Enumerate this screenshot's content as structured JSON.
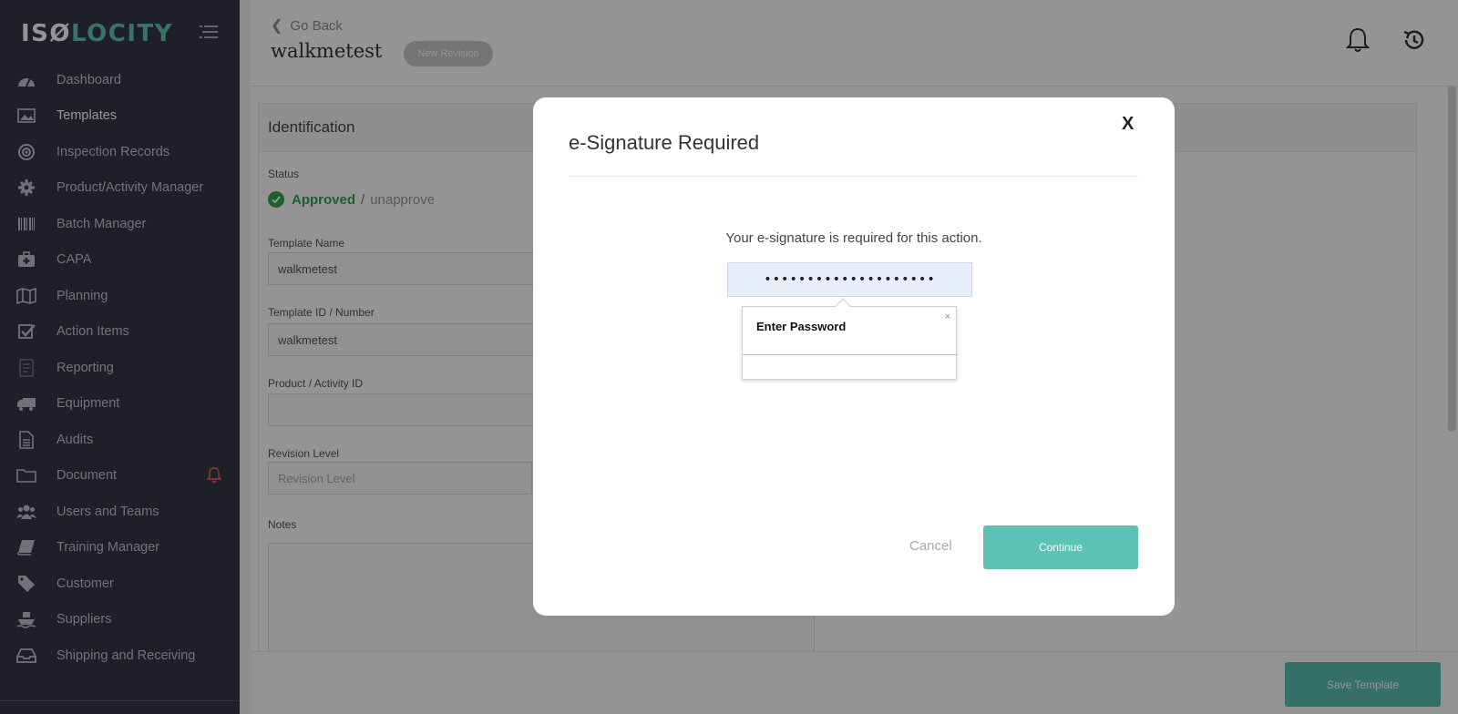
{
  "app": {
    "logo_prefix": "IS",
    "logo_mid": "Ø",
    "logo_suffix": "LOCITY"
  },
  "sidebar": {
    "items": [
      {
        "label": "Dashboard",
        "icon": "dashboard-icon"
      },
      {
        "label": "Templates",
        "icon": "image-icon",
        "active": true
      },
      {
        "label": "Inspection Records",
        "icon": "target-icon"
      },
      {
        "label": "Product/Activity Manager",
        "icon": "gear-icon"
      },
      {
        "label": "Batch Manager",
        "icon": "barcode-icon"
      },
      {
        "label": "CAPA",
        "icon": "medkit-icon"
      },
      {
        "label": "Planning",
        "icon": "map-icon"
      },
      {
        "label": "Action Items",
        "icon": "checkbox-icon"
      },
      {
        "label": "Reporting",
        "icon": "report-icon"
      },
      {
        "label": "Equipment",
        "icon": "truck-icon"
      },
      {
        "label": "Audits",
        "icon": "file-icon"
      },
      {
        "label": "Document",
        "icon": "folder-icon",
        "alert": true
      },
      {
        "label": "Users and Teams",
        "icon": "users-icon"
      },
      {
        "label": "Training Manager",
        "icon": "book-icon"
      },
      {
        "label": "Customer",
        "icon": "tag-icon"
      },
      {
        "label": "Suppliers",
        "icon": "ship-icon"
      },
      {
        "label": "Shipping and Receiving",
        "icon": "inbox-icon"
      }
    ]
  },
  "header": {
    "go_back": "Go Back",
    "title": "walkmetest",
    "revision_button": "New Revision"
  },
  "form": {
    "section_title": "Identification",
    "status_label": "Status",
    "status_value": "Approved",
    "status_separator": "/",
    "unapprove_link": "unapprove",
    "template_name_label": "Template Name",
    "template_name_value": "walkmetest",
    "template_id_label": "Template ID / Number",
    "template_id_value": "walkmetest",
    "product_id_label": "Product / Activity ID",
    "product_id_value": "",
    "revision_label": "Revision Level",
    "revision_placeholder": "Revision Level",
    "notes_label": "Notes",
    "save_button": "Save Template"
  },
  "modal": {
    "close": "X",
    "title": "e-Signature Required",
    "message": "Your e-signature is required for this action.",
    "password_value": "••••••••••••••••••••",
    "tooltip_text": "Enter Password",
    "tooltip_close": "×",
    "cancel": "Cancel",
    "continue": "Continue"
  },
  "colors": {
    "sidebar_bg": "#363844",
    "accent_teal": "#5bc2b4",
    "approved_green": "#2fa84f",
    "alert_red": "#e05a5a"
  }
}
